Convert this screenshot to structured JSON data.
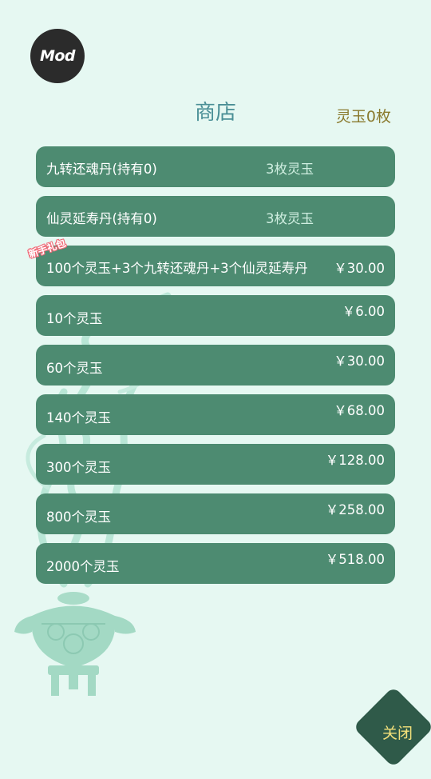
{
  "header": {
    "mod_badge": "Mod",
    "title": "商店",
    "balance": "灵玉0枚"
  },
  "items": [
    {
      "name": "九转还魂丹(持有0)",
      "cost": "3枚灵玉"
    },
    {
      "name": "仙灵延寿丹(持有0)",
      "cost": "3枚灵玉"
    },
    {
      "name": "100个灵玉+3个九转还魂丹+3个仙灵延寿丹",
      "price": "￥30.00",
      "tag": "新手礼包"
    },
    {
      "name": "10个灵玉",
      "price": "￥6.00"
    },
    {
      "name": "60个灵玉",
      "price": "￥30.00"
    },
    {
      "name": "140个灵玉",
      "price": "￥68.00"
    },
    {
      "name": "300个灵玉",
      "price": "￥128.00"
    },
    {
      "name": "800个灵玉",
      "price": "￥258.00"
    },
    {
      "name": "2000个灵玉",
      "price": "￥518.00"
    }
  ],
  "close_label": "关闭",
  "colors": {
    "background": "#e6f8f2",
    "row": "#4d8b71",
    "title": "#4a8f96",
    "balance": "#8a7a2e",
    "close_button": "#2f5a49",
    "close_text": "#f3e07a",
    "gift_tag_outline": "#f06a78"
  }
}
